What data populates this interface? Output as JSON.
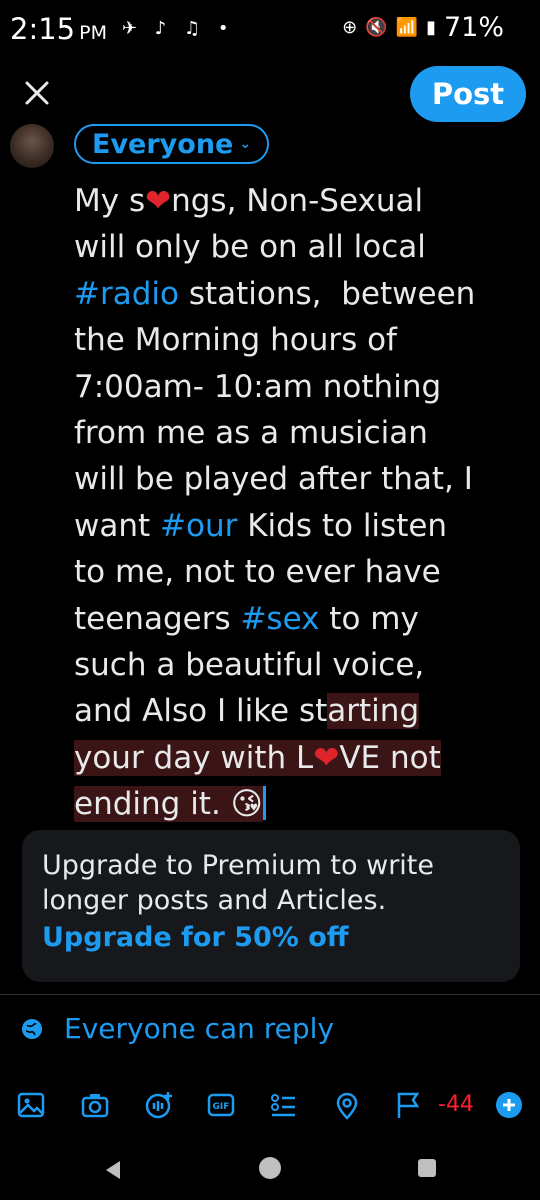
{
  "status_bar": {
    "time": "2:15",
    "ampm": "PM",
    "left_icons": "✈ ♪ ♫ •",
    "battery": "71%"
  },
  "composer": {
    "post_label": "Post",
    "audience_label": "Everyone",
    "text_parts": [
      "My s",
      "❤",
      "ngs, Non-Sexual\nwill only be on all local\n",
      "#radio",
      " stations,  between\nthe Morning hours of\n7:00am- 10:am nothing\nfrom me as a musician\nwill be played after that, I\nwant ",
      "#our",
      " Kids to listen\nto me, not to ever have\nteenagers ",
      "#sex",
      " to my\nsuch a beautiful voice,\nand Also I like st",
      "arting\nyour day with L",
      "❤",
      "VE not\nending it. ",
      "😘"
    ]
  },
  "premium": {
    "line1": "Upgrade to Premium to write",
    "line2": "longer posts and Articles.",
    "link": "Upgrade for 50% off"
  },
  "reply_setting": "Everyone can reply",
  "char_counter": "-44",
  "colors": {
    "accent": "#1d9bf0",
    "background": "#000000",
    "heart": "#e0242c",
    "counter_red": "#f4212e",
    "highlight": "#3b1416"
  },
  "toolbar_icons": [
    "image-icon",
    "camera-icon",
    "grok-icon",
    "gif-icon",
    "poll-icon",
    "location-icon",
    "flag-icon",
    "add-post-icon"
  ]
}
